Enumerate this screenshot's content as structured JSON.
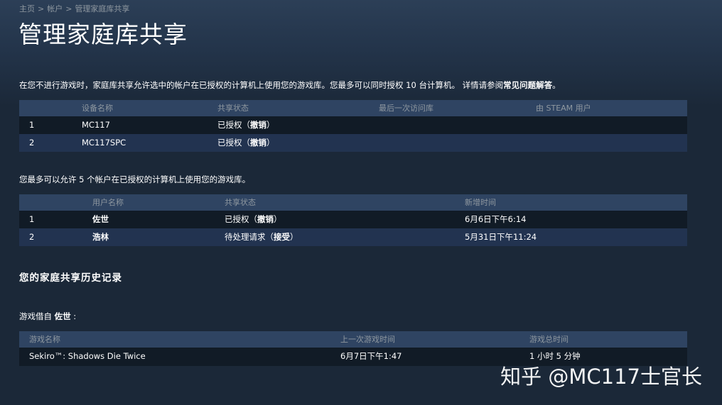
{
  "breadcrumb": {
    "home": "主页",
    "account": "帐户",
    "current": "管理家庭库共享",
    "separator": ">"
  },
  "page_title": "管理家庭库共享",
  "intro": {
    "text": "在您不进行游戏时，家庭库共享允许选中的帐户在已授权的计算机上使用您的游戏库。您最多可以同时授权 10 台计算机。 详情请参阅",
    "faq_link": "常见问题解答",
    "suffix": "。"
  },
  "devices": {
    "headers": {
      "name": "设备名称",
      "status": "共享状态",
      "last_access": "最后一次访问库",
      "by_user": "由 STEAM 用户"
    },
    "rows": [
      {
        "index": "1",
        "name": "MC117",
        "status": "已授权",
        "action": "撤销",
        "last_access": "",
        "by_user": ""
      },
      {
        "index": "2",
        "name": "MC117SPC",
        "status": "已授权",
        "action": "撤销",
        "last_access": "",
        "by_user": ""
      }
    ]
  },
  "accounts_intro": "您最多可以允许 5 个帐户在已授权的计算机上使用您的游戏库。",
  "accounts": {
    "headers": {
      "name": "用户名称",
      "status": "共享状态",
      "added": "新增时间"
    },
    "rows": [
      {
        "index": "1",
        "name": "佐世",
        "status": "已授权",
        "action": "撤销",
        "added": "6月6日下午6:14"
      },
      {
        "index": "2",
        "name": "浩林",
        "status": "待处理请求",
        "action": "接受",
        "added": "5月31日下午11:24"
      }
    ]
  },
  "history_title": "您的家庭共享历史记录",
  "borrowed": {
    "prefix": "游戏借自",
    "lender": "佐世",
    "suffix": " :"
  },
  "games": {
    "headers": {
      "name": "游戏名称",
      "last_played": "上一次游戏时间",
      "total_time": "游戏总时间"
    },
    "rows": [
      {
        "name": "Sekiro™: Shadows Die Twice",
        "last_played": "6月7日下午1:47",
        "total_time": "1 小时 5 分钟"
      }
    ]
  },
  "watermark": "知乎 @MC117士官长",
  "colors": {
    "background": "#1b2838",
    "header_row": "#2f4462",
    "row_dark": "#111b26",
    "row_light": "#223350",
    "muted_text": "#8f98a0"
  }
}
